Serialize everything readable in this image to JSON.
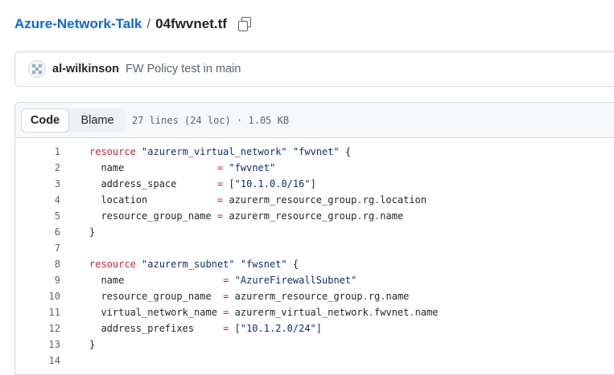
{
  "breadcrumb": {
    "repo": "Azure-Network-Talk",
    "separator": "/",
    "file": "04fwvnet.tf",
    "copy_icon": "copy-icon"
  },
  "commit": {
    "author": "al-wilkinson",
    "message": "FW Policy test in main",
    "avatar_icon": "identicon"
  },
  "file_header": {
    "code_label": "Code",
    "blame_label": "Blame",
    "info": "27 lines (24 loc) · 1.05 KB"
  },
  "code_lines": [
    {
      "n": "1",
      "segs": [
        {
          "t": "resource",
          "c": "kw"
        },
        {
          "t": " "
        },
        {
          "t": "\"azurerm_virtual_network\"",
          "c": "str"
        },
        {
          "t": " "
        },
        {
          "t": "\"fwvnet\"",
          "c": "str"
        },
        {
          "t": " {"
        }
      ]
    },
    {
      "n": "2",
      "segs": [
        {
          "t": "  name                "
        },
        {
          "t": "=",
          "c": "op"
        },
        {
          "t": " "
        },
        {
          "t": "\"fwvnet\"",
          "c": "str"
        }
      ]
    },
    {
      "n": "3",
      "segs": [
        {
          "t": "  address_space       "
        },
        {
          "t": "=",
          "c": "op"
        },
        {
          "t": " ["
        },
        {
          "t": "\"10.1.0.0/16\"",
          "c": "str"
        },
        {
          "t": "]"
        }
      ]
    },
    {
      "n": "4",
      "segs": [
        {
          "t": "  location            "
        },
        {
          "t": "=",
          "c": "op"
        },
        {
          "t": " azurerm_resource_group"
        },
        {
          "t": ".",
          "c": "op"
        },
        {
          "t": "rg"
        },
        {
          "t": ".",
          "c": "op"
        },
        {
          "t": "location"
        }
      ]
    },
    {
      "n": "5",
      "segs": [
        {
          "t": "  resource_group_name "
        },
        {
          "t": "=",
          "c": "op"
        },
        {
          "t": " azurerm_resource_group"
        },
        {
          "t": ".",
          "c": "op"
        },
        {
          "t": "rg"
        },
        {
          "t": ".",
          "c": "op"
        },
        {
          "t": "name"
        }
      ]
    },
    {
      "n": "6",
      "segs": [
        {
          "t": "}"
        }
      ]
    },
    {
      "n": "7",
      "segs": [
        {
          "t": ""
        }
      ]
    },
    {
      "n": "8",
      "segs": [
        {
          "t": "resource",
          "c": "kw"
        },
        {
          "t": " "
        },
        {
          "t": "\"azurerm_subnet\"",
          "c": "str"
        },
        {
          "t": " "
        },
        {
          "t": "\"fwsnet\"",
          "c": "str"
        },
        {
          "t": " {"
        }
      ]
    },
    {
      "n": "9",
      "segs": [
        {
          "t": "  name                 "
        },
        {
          "t": "=",
          "c": "op"
        },
        {
          "t": " "
        },
        {
          "t": "\"AzureFirewallSubnet\"",
          "c": "str"
        }
      ]
    },
    {
      "n": "10",
      "segs": [
        {
          "t": "  resource_group_name  "
        },
        {
          "t": "=",
          "c": "op"
        },
        {
          "t": " azurerm_resource_group"
        },
        {
          "t": ".",
          "c": "op"
        },
        {
          "t": "rg"
        },
        {
          "t": ".",
          "c": "op"
        },
        {
          "t": "name"
        }
      ]
    },
    {
      "n": "11",
      "segs": [
        {
          "t": "  virtual_network_name "
        },
        {
          "t": "=",
          "c": "op"
        },
        {
          "t": " azurerm_virtual_network"
        },
        {
          "t": ".",
          "c": "op"
        },
        {
          "t": "fwvnet"
        },
        {
          "t": ".",
          "c": "op"
        },
        {
          "t": "name"
        }
      ]
    },
    {
      "n": "12",
      "segs": [
        {
          "t": "  address_prefixes     "
        },
        {
          "t": "=",
          "c": "op"
        },
        {
          "t": " ["
        },
        {
          "t": "\"10.1.2.0/24\"",
          "c": "str"
        },
        {
          "t": "]"
        }
      ]
    },
    {
      "n": "13",
      "segs": [
        {
          "t": "}"
        }
      ]
    },
    {
      "n": "14",
      "segs": [
        {
          "t": ""
        }
      ]
    }
  ],
  "colors": {
    "link": "#0969da",
    "keyword": "#cf222e",
    "string": "#0a3069",
    "muted": "#59636e",
    "border": "#d1d9e0"
  }
}
